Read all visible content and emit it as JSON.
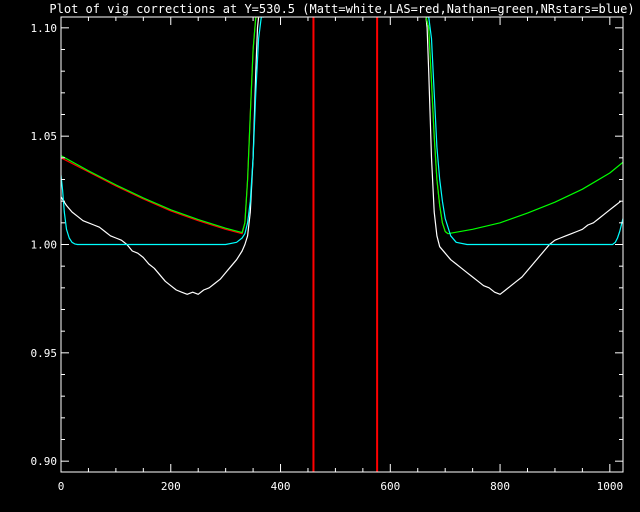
{
  "chart_data": {
    "type": "line",
    "title": "Plot of vig corrections at Y=530.5 (Matt=white,LAS=red,Nathan=green,NRstars=blue)",
    "xlabel": "",
    "ylabel": "",
    "xlim": [
      0,
      1024
    ],
    "ylim": [
      0.895,
      1.105
    ],
    "x_ticks": [
      0,
      200,
      400,
      600,
      800,
      1000
    ],
    "x_tick_labels": [
      "0",
      "200",
      "400",
      "600",
      "800",
      "1000"
    ],
    "y_ticks": [
      0.9,
      0.95,
      1.0,
      1.05,
      1.1
    ],
    "y_tick_labels": [
      "0.90",
      "0.95",
      "1.00",
      "1.05",
      "1.10"
    ],
    "grid": false,
    "colors": {
      "background": "#000000",
      "axes": "#ffffff",
      "matt": "#ffffff",
      "las": "#ff0000",
      "nathan": "#00ff00",
      "nrstars": "#00ffff"
    },
    "series": [
      {
        "key": "matt",
        "x": [
          0,
          5,
          10,
          20,
          30,
          40,
          50,
          60,
          70,
          80,
          90,
          100,
          110,
          120,
          130,
          140,
          150,
          160,
          170,
          180,
          190,
          200,
          210,
          220,
          230,
          240,
          250,
          260,
          270,
          280,
          290,
          300,
          310,
          320,
          330,
          335,
          340,
          345,
          350,
          355,
          358,
          360
        ],
        "y": [
          1.022,
          1.02,
          1.018,
          1.015,
          1.013,
          1.011,
          1.01,
          1.009,
          1.008,
          1.006,
          1.004,
          1.003,
          1.002,
          1.0,
          0.997,
          0.996,
          0.994,
          0.991,
          0.989,
          0.986,
          0.983,
          0.981,
          0.979,
          0.978,
          0.977,
          0.978,
          0.977,
          0.979,
          0.98,
          0.982,
          0.984,
          0.987,
          0.99,
          0.993,
          0.997,
          1.0,
          1.004,
          1.015,
          1.04,
          1.08,
          1.1,
          1.105
        ]
      },
      {
        "key": "matt",
        "x": [
          665,
          667,
          670,
          675,
          680,
          685,
          690,
          700,
          710,
          720,
          730,
          740,
          750,
          760,
          770,
          780,
          790,
          800,
          810,
          820,
          830,
          840,
          850,
          860,
          870,
          880,
          890,
          900,
          910,
          920,
          930,
          940,
          950,
          960,
          970,
          980,
          990,
          1000,
          1010,
          1015,
          1020
        ],
        "y": [
          1.105,
          1.1,
          1.08,
          1.04,
          1.015,
          1.004,
          0.999,
          0.996,
          0.993,
          0.991,
          0.989,
          0.987,
          0.985,
          0.983,
          0.981,
          0.98,
          0.978,
          0.977,
          0.979,
          0.981,
          0.983,
          0.985,
          0.988,
          0.991,
          0.994,
          0.997,
          1.0,
          1.002,
          1.003,
          1.004,
          1.005,
          1.006,
          1.007,
          1.009,
          1.01,
          1.012,
          1.014,
          1.016,
          1.018,
          1.019,
          1.02
        ]
      },
      {
        "key": "las",
        "x": [
          0,
          50,
          100,
          150,
          200,
          250,
          300,
          330,
          335,
          340,
          345,
          350,
          355,
          360
        ],
        "y": [
          1.04,
          1.0335,
          1.027,
          1.021,
          1.0155,
          1.011,
          1.007,
          1.005,
          1.01,
          1.03,
          1.06,
          1.09,
          1.105,
          1.105
        ]
      },
      {
        "key": "las",
        "x": [
          665,
          670,
          675,
          680,
          685,
          690,
          695,
          700,
          705
        ],
        "y": [
          1.105,
          1.1,
          1.075,
          1.05,
          1.03,
          1.018,
          1.01,
          1.006,
          1.005
        ]
      },
      {
        "key": "nathan",
        "x": [
          0,
          50,
          100,
          150,
          200,
          250,
          300,
          330,
          335,
          340,
          345,
          350,
          355,
          360
        ],
        "y": [
          1.041,
          1.034,
          1.0275,
          1.0215,
          1.016,
          1.0115,
          1.0075,
          1.0055,
          1.01,
          1.03,
          1.06,
          1.09,
          1.105,
          1.105
        ]
      },
      {
        "key": "nathan",
        "x": [
          665,
          670,
          675,
          680,
          685,
          690,
          695,
          700,
          705,
          750,
          800,
          850,
          900,
          950,
          1000,
          1024
        ],
        "y": [
          1.105,
          1.1,
          1.075,
          1.05,
          1.03,
          1.018,
          1.01,
          1.006,
          1.005,
          1.007,
          1.01,
          1.0145,
          1.0195,
          1.0255,
          1.033,
          1.038
        ]
      },
      {
        "key": "nrstars",
        "x": [
          0,
          3,
          6,
          10,
          15,
          20,
          25,
          30,
          40,
          60,
          100,
          200,
          300,
          320,
          330,
          335,
          340,
          345,
          350,
          355,
          360,
          365,
          370
        ],
        "y": [
          1.032,
          1.025,
          1.015,
          1.007,
          1.003,
          1.001,
          1.0003,
          1.0,
          1.0,
          1.0,
          1.0,
          1.0,
          1.0,
          1.001,
          1.003,
          1.005,
          1.01,
          1.02,
          1.04,
          1.07,
          1.095,
          1.105,
          1.105
        ]
      },
      {
        "key": "nrstars",
        "x": [
          665,
          670,
          675,
          680,
          685,
          690,
          695,
          700,
          710,
          720,
          740,
          800,
          900,
          1000,
          1005,
          1010,
          1014,
          1018,
          1022,
          1024
        ],
        "y": [
          1.105,
          1.105,
          1.095,
          1.07,
          1.045,
          1.03,
          1.02,
          1.012,
          1.004,
          1.001,
          1.0,
          1.0,
          1.0,
          1.0,
          1.0,
          1.001,
          1.003,
          1.006,
          1.01,
          1.012
        ]
      }
    ],
    "vertical_lines": [
      {
        "x": 460,
        "color": "#ff0000"
      },
      {
        "x": 576,
        "color": "#ff0000"
      }
    ]
  }
}
